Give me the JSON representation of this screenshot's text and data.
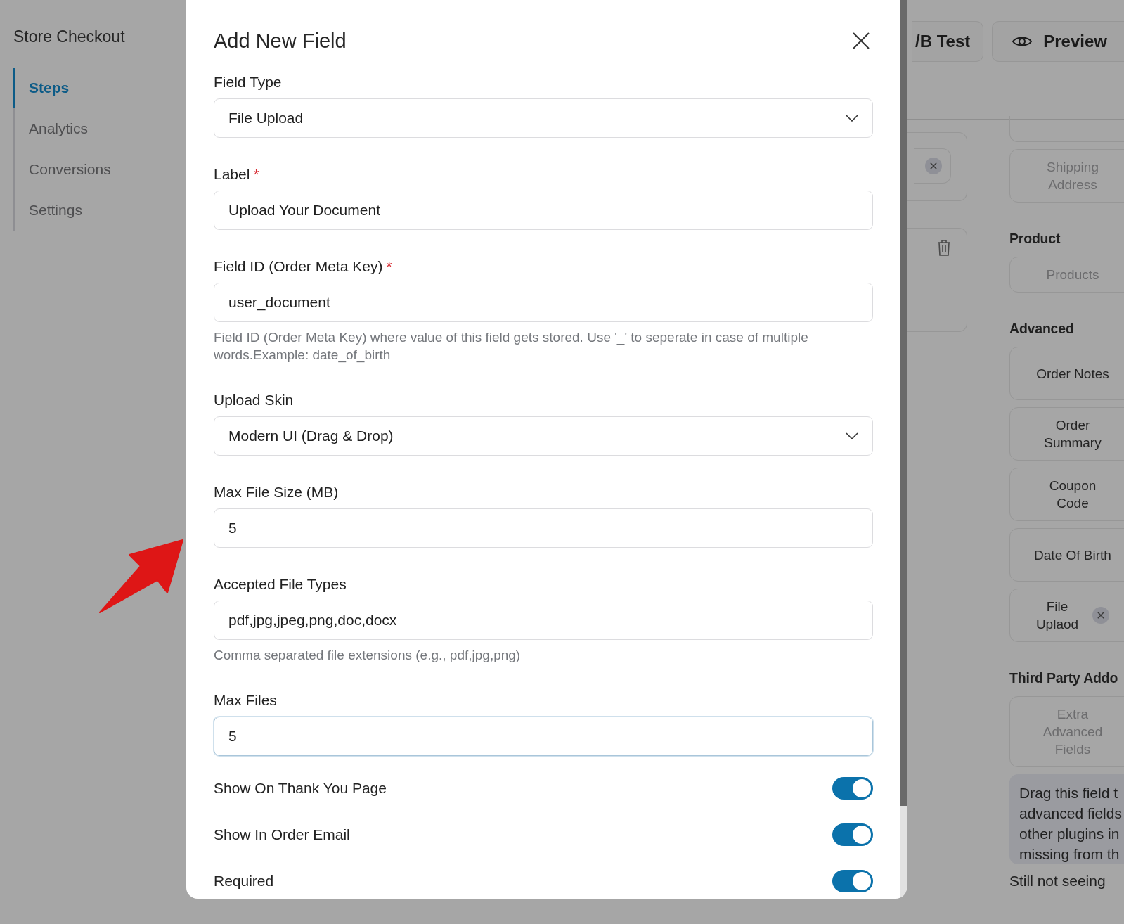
{
  "sidebar": {
    "title": "Store Checkout",
    "items": [
      {
        "label": "Steps",
        "selected": true
      },
      {
        "label": "Analytics",
        "selected": false
      },
      {
        "label": "Conversions",
        "selected": false
      },
      {
        "label": "Settings",
        "selected": false
      }
    ]
  },
  "header": {
    "buttons": [
      {
        "label": "/B Test",
        "kind": "plain"
      },
      {
        "label": "Preview",
        "kind": "preview"
      }
    ]
  },
  "canvas": {
    "cards": [
      {
        "kind": "chip"
      },
      {
        "kind": "trash"
      }
    ]
  },
  "palette": [
    {
      "kind": "stub"
    },
    {
      "kind": "item",
      "label": "Shipping\nAddress",
      "disabled": true
    },
    {
      "kind": "heading",
      "label": "Product"
    },
    {
      "kind": "item",
      "label": "Products",
      "disabled": true
    },
    {
      "kind": "heading",
      "label": "Advanced"
    },
    {
      "kind": "item",
      "label": "Order Notes",
      "disabled": false
    },
    {
      "kind": "item",
      "label": "Order\nSummary",
      "disabled": false
    },
    {
      "kind": "item",
      "label": "Coupon\nCode",
      "disabled": false
    },
    {
      "kind": "item",
      "label": "Date Of Birth",
      "disabled": false
    },
    {
      "kind": "item",
      "label": "File\nUplaod",
      "disabled": false,
      "removable": true
    },
    {
      "kind": "heading",
      "label": "Third Party Addo"
    },
    {
      "kind": "item",
      "label": "Extra\nAdvanced\nFields",
      "disabled": true
    },
    {
      "kind": "note",
      "lines": [
        "Drag this field t",
        "advanced fields",
        "other plugins in",
        "missing from th"
      ],
      "more": "Still not seeing"
    }
  ],
  "modal": {
    "title": "Add New Field",
    "fields": [
      {
        "kind": "select",
        "label": "Field Type",
        "value": "File Upload",
        "focused": false
      },
      {
        "kind": "input",
        "label": "Label",
        "required_mark": "*",
        "value": "Upload Your Document",
        "focused": false
      },
      {
        "kind": "input",
        "label": "Field ID (Order Meta Key)",
        "required_mark": "*",
        "value": "user_document",
        "focused": false,
        "help": "Field ID (Order Meta Key) where value of this field gets stored. Use '_' to seperate in case of multiple words.Example: date_of_birth"
      },
      {
        "kind": "select",
        "label": "Upload Skin",
        "value": "Modern UI (Drag & Drop)",
        "focused": false
      },
      {
        "kind": "input",
        "label": "Max File Size (MB)",
        "value": "5",
        "focused": false
      },
      {
        "kind": "input",
        "label": "Accepted File Types",
        "value": "pdf,jpg,jpeg,png,doc,docx",
        "focused": false,
        "help": "Comma separated file extensions (e.g., pdf,jpg,png)"
      },
      {
        "kind": "input",
        "label": "Max Files",
        "value": "5",
        "focused": true
      },
      {
        "kind": "toggle",
        "label": "Show On Thank You Page",
        "on": true
      },
      {
        "kind": "toggle",
        "label": "Show In Order Email",
        "on": true
      },
      {
        "kind": "toggle",
        "label": "Required",
        "on": true
      }
    ]
  }
}
